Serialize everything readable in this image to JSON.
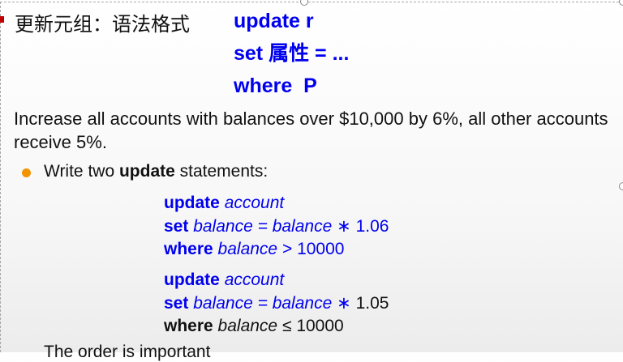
{
  "slide": {
    "title_cn": "更新元组：语法格式",
    "syntax": {
      "line1": "update r",
      "line2": "set 属性 = ...",
      "line3": "where  P"
    },
    "description": "Increase all accounts with balances over $10,000 by 6%, all other accounts receive 5%.",
    "bullet": {
      "prefix": "Write two ",
      "keyword": "update",
      "suffix": " statements:"
    },
    "stmt1": {
      "update_kw": "update",
      "table": "account",
      "set_kw": "set",
      "set_expr": "balance = balance",
      "op": "∗",
      "factor": "1.06",
      "where_kw": "where",
      "where_attr": "balance",
      "where_op": ">",
      "where_val": "10000"
    },
    "stmt2": {
      "update_kw": "update",
      "table": "account",
      "set_kw": "set",
      "set_expr": "balance = balance",
      "op": "∗",
      "factor": "1.05",
      "where_kw": "where",
      "where_attr": "balance",
      "where_op": "≤",
      "where_val": "10000"
    },
    "cut_off_line": "The order is important"
  },
  "colors": {
    "keyword_blue": "#0000ee",
    "bullet_orange": "#f29400",
    "marker_red": "#c00000"
  }
}
